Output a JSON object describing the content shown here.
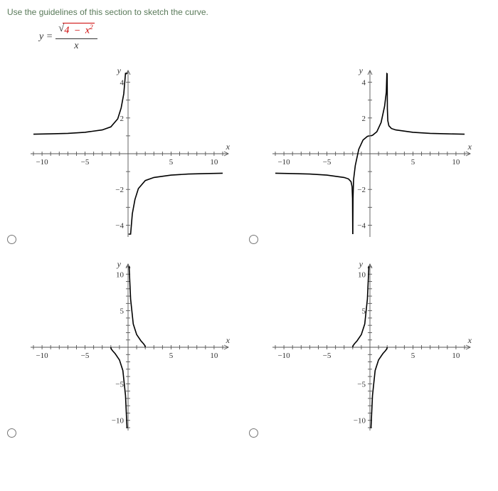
{
  "instruction": "Use the guidelines of this section to sketch the curve.",
  "equation": {
    "lhs": "y =",
    "radicand_a": "4",
    "radicand_op": "−",
    "radicand_b": "x",
    "radicand_exp": "2",
    "denominator": "x"
  },
  "chart_data": [
    {
      "type": "line",
      "xlabel": "x",
      "ylabel": "y",
      "xlim": [
        -11,
        11
      ],
      "ylim": [
        -4.5,
        4.5
      ],
      "xticks": [
        -10,
        -5,
        5,
        10
      ],
      "yticks": [
        -4,
        -2,
        2,
        4
      ],
      "series": [
        {
          "name": "left",
          "x": [
            -11,
            -9,
            -7,
            -5,
            -3,
            -2,
            -1.2,
            -0.8,
            -0.5,
            -0.3,
            -0.15,
            -0.06
          ],
          "y": [
            1.09,
            1.11,
            1.14,
            1.2,
            1.33,
            1.5,
            1.95,
            2.56,
            3.36,
            4.5,
            4.5,
            4.5
          ]
        },
        {
          "name": "right",
          "x": [
            0.06,
            0.15,
            0.3,
            0.5,
            0.8,
            1.2,
            2,
            3,
            5,
            7,
            9,
            11
          ],
          "y": [
            -4.5,
            -4.5,
            -4.5,
            -3.36,
            -2.56,
            -1.95,
            -1.5,
            -1.33,
            -1.2,
            -1.14,
            -1.11,
            -1.09
          ]
        }
      ]
    },
    {
      "type": "line",
      "xlabel": "x",
      "ylabel": "y",
      "xlim": [
        -11,
        11
      ],
      "ylim": [
        -4.5,
        4.5
      ],
      "xticks": [
        -10,
        -5,
        5,
        10
      ],
      "yticks": [
        -4,
        -2,
        2,
        4
      ],
      "series": [
        {
          "name": "left",
          "x": [
            -11,
            -9,
            -7,
            -5,
            -3,
            -2.5,
            -2.2,
            -2.08,
            -2.03,
            -2.005
          ],
          "y": [
            -1.09,
            -1.11,
            -1.14,
            -1.2,
            -1.33,
            -1.41,
            -1.565,
            -1.85,
            -2.5,
            -4.5
          ]
        },
        {
          "name": "mid-left",
          "x": [
            -1.995,
            -1.97,
            -1.9,
            -1.7,
            -1.3,
            -0.8,
            -0.3,
            -0.05
          ],
          "y": [
            -4.5,
            -2.5,
            -1.45,
            -0.66,
            0.25,
            0.77,
            0.97,
            1
          ]
        },
        {
          "name": "mid-right",
          "x": [
            0.05,
            0.3,
            0.8,
            1.3,
            1.7,
            1.9,
            1.97,
            1.995
          ],
          "y": [
            1,
            1.03,
            1.23,
            1.75,
            2.66,
            3.45,
            4.5,
            4.5
          ]
        },
        {
          "name": "right",
          "x": [
            2.005,
            2.03,
            2.08,
            2.2,
            2.5,
            3,
            5,
            7,
            9,
            11
          ],
          "y": [
            4.5,
            2.5,
            1.85,
            1.565,
            1.41,
            1.33,
            1.2,
            1.14,
            1.11,
            1.09
          ]
        }
      ]
    },
    {
      "type": "line",
      "xlabel": "x",
      "ylabel": "y",
      "xlim": [
        -11,
        11
      ],
      "ylim": [
        -11,
        11
      ],
      "xticks": [
        -10,
        -5,
        5,
        10
      ],
      "yticks": [
        -10,
        -5,
        5,
        10
      ],
      "series": [
        {
          "name": "left",
          "x": [
            -2,
            -1.99,
            -1.95,
            -1.8,
            -1.5,
            -1,
            -0.6,
            -0.3,
            -0.12,
            -0.05
          ],
          "y": [
            0,
            -0.1,
            -0.23,
            -0.48,
            -0.88,
            -1.73,
            -3.18,
            -6.59,
            -11,
            -11
          ]
        },
        {
          "name": "right",
          "x": [
            0.05,
            0.12,
            0.3,
            0.6,
            1,
            1.5,
            1.8,
            1.95,
            1.99,
            2
          ],
          "y": [
            11,
            11,
            6.59,
            3.18,
            1.73,
            0.88,
            0.48,
            0.23,
            0.1,
            0
          ]
        }
      ]
    },
    {
      "type": "line",
      "xlabel": "x",
      "ylabel": "y",
      "xlim": [
        -11,
        11
      ],
      "ylim": [
        -11,
        11
      ],
      "xticks": [
        -10,
        -5,
        5,
        10
      ],
      "yticks": [
        -10,
        -5,
        5,
        10
      ],
      "series": [
        {
          "name": "left",
          "x": [
            -2,
            -1.99,
            -1.95,
            -1.8,
            -1.5,
            -1,
            -0.6,
            -0.3,
            -0.12,
            -0.05
          ],
          "y": [
            0,
            0.1,
            0.23,
            0.48,
            0.88,
            1.73,
            3.18,
            6.59,
            11,
            11
          ]
        },
        {
          "name": "right",
          "x": [
            0.05,
            0.12,
            0.3,
            0.6,
            1,
            1.5,
            1.8,
            1.95,
            1.99,
            2
          ],
          "y": [
            -11,
            -11,
            -6.59,
            -3.18,
            -1.73,
            -0.88,
            -0.48,
            -0.23,
            -0.1,
            0
          ]
        }
      ]
    }
  ]
}
